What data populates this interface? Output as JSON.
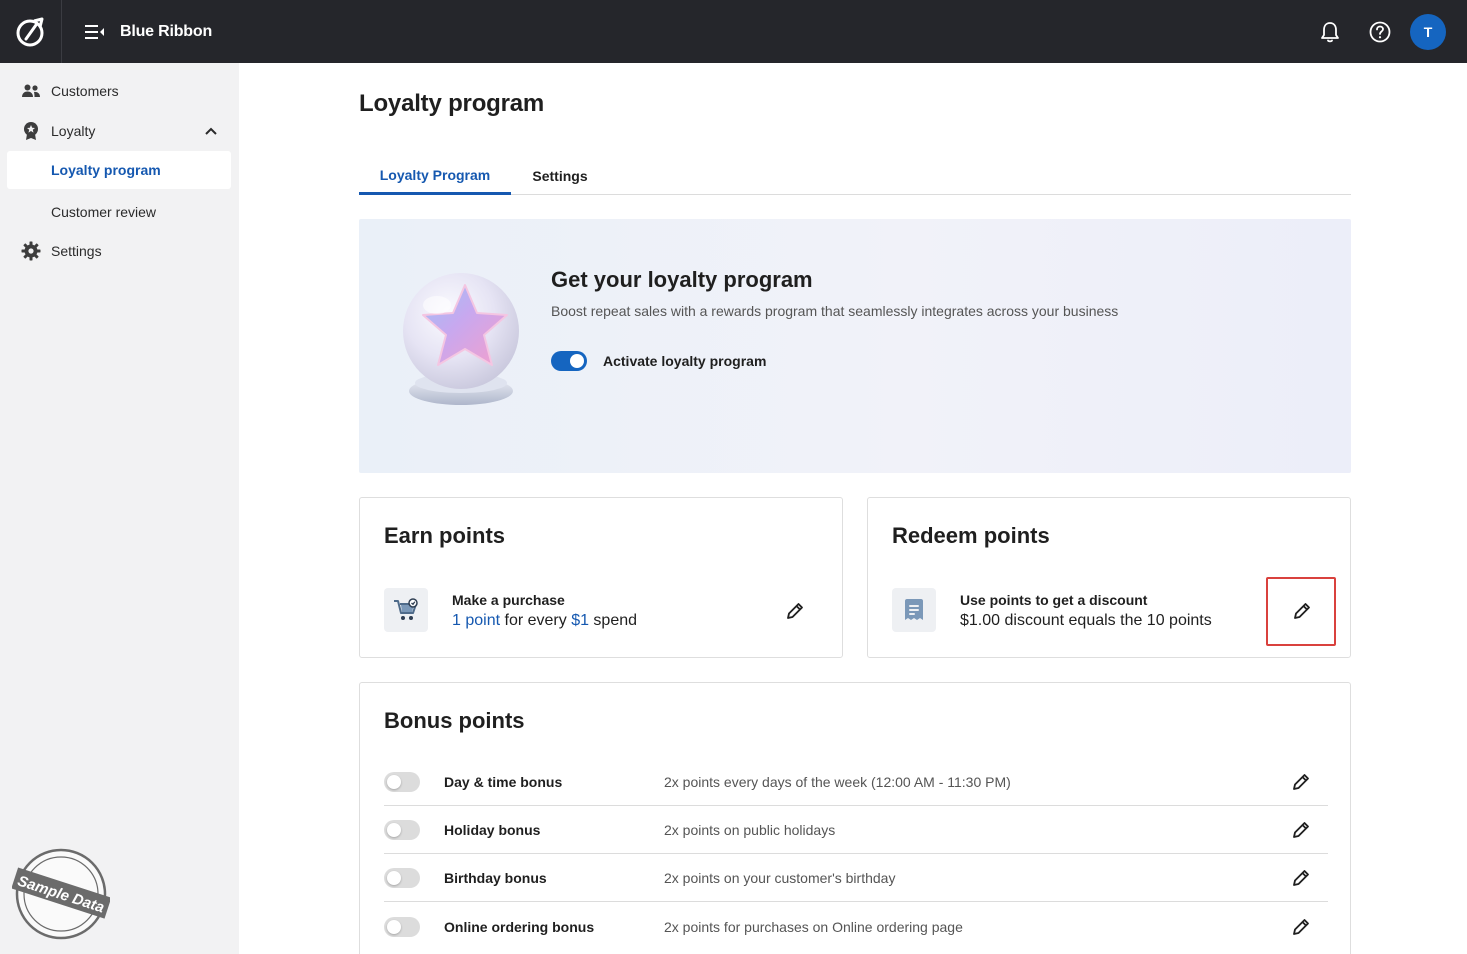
{
  "app": {
    "brand": "Blue Ribbon",
    "user_initial": "T"
  },
  "icons": {
    "logo": "brand-logo-icon",
    "menu": "menu-collapse-icon",
    "bell": "bell-icon",
    "help": "help-icon"
  },
  "sidebar": {
    "items": [
      {
        "label": "Customers",
        "icon": "customers-icon"
      },
      {
        "label": "Loyalty",
        "icon": "loyalty-badge-icon",
        "expanded": true
      },
      {
        "label": "Loyalty program",
        "active": true
      },
      {
        "label": "Customer review"
      },
      {
        "label": "Settings",
        "icon": "gear-icon"
      }
    ],
    "stamp": "Sample Data"
  },
  "page": {
    "title": "Loyalty program",
    "tabs": [
      {
        "label": "Loyalty Program",
        "active": true
      },
      {
        "label": "Settings"
      }
    ]
  },
  "hero": {
    "title": "Get your loyalty program",
    "subtitle": "Boost repeat sales with a rewards program that seamlessly integrates across your business",
    "toggle_label": "Activate loyalty program",
    "toggle_on": true
  },
  "earn": {
    "title": "Earn points",
    "row_title": "Make a purchase",
    "desc_points": "1 point",
    "desc_mid": " for every ",
    "desc_amount": "$1",
    "desc_end": " spend"
  },
  "redeem": {
    "title": "Redeem points",
    "row_title": "Use points to get a discount",
    "desc": "$1.00 discount equals the 10 points"
  },
  "bonus": {
    "title": "Bonus points",
    "rows": [
      {
        "name": "Day & time bonus",
        "desc": "2x points every days of the week (12:00 AM - 11:30 PM)",
        "enabled": false
      },
      {
        "name": "Holiday bonus",
        "desc": "2x points on public holidays",
        "enabled": false
      },
      {
        "name": "Birthday bonus",
        "desc": "2x points on your customer's birthday",
        "enabled": false
      },
      {
        "name": "Online ordering bonus",
        "desc": "2x points for purchases on Online ordering page",
        "enabled": false
      }
    ]
  },
  "colors": {
    "topbar": "#25262b",
    "accent": "#1558b0",
    "highlight": "#d9413d"
  }
}
